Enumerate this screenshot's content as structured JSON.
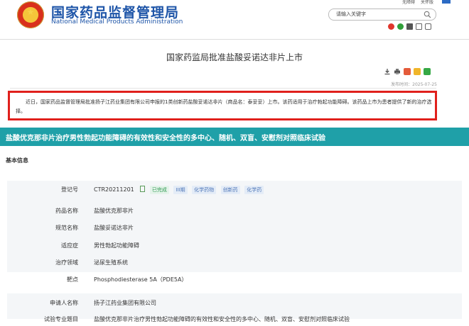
{
  "header": {
    "site_name_cn": "国家药品监督管理局",
    "site_name_en": "National Medical Products Administration",
    "top_links": [
      "无障碍",
      "关怀版"
    ],
    "search_placeholder": "请输入关键字"
  },
  "article": {
    "title": "国家药监局批准盐酸妥诺达非片上市",
    "date": "发布时间：2025-07-25",
    "summary": "近日，国家药品监督管理局批准扬子江药业集团有限公司申报的1类创新药盐酸妥诺达非片（商品名：泰妥妥）上市。该药适用于治疗勃起功能障碍。该药品上市为患者提供了新的治疗选择。"
  },
  "trial": {
    "banner_title": "盐酸优克那非片治疗男性勃起功能障碍的有效性和安全性的多中心、随机、双盲、安慰剂对照临床试验",
    "section_label": "基本信息",
    "registration": {
      "label": "登记号",
      "value": "CTR20211201",
      "tags": [
        "已完成",
        "III期",
        "化学药物",
        "创新药",
        "化学药"
      ]
    },
    "rows": [
      {
        "label": "药品名称",
        "value": "盐酸优克那非片"
      },
      {
        "label": "规范名称",
        "value": "盐酸妥诺达非片"
      },
      {
        "label": "适应症",
        "value": "男性勃起功能障碍"
      },
      {
        "label": "治疗领域",
        "value": "泌尿生殖系统"
      },
      {
        "label": "靶点",
        "value": "Phosphodiesterase 5A（PDE5A）"
      }
    ],
    "applicant": {
      "label": "申请人名称",
      "value": "扬子江药业集团有限公司"
    },
    "partial_row": {
      "label": "试验专业题目",
      "value": "盐酸优克那非片治疗男性勃起功能障碍的有效性和安全性的多中心、随机、双盲、安慰剂对照临床试验"
    }
  },
  "colors": {
    "brand_blue": "#1e55a8",
    "highlight_red": "#e0201c",
    "banner_teal": "#1fa0a8",
    "tag_green": "#2f9a52",
    "tag_blue": "#4f77b8"
  }
}
